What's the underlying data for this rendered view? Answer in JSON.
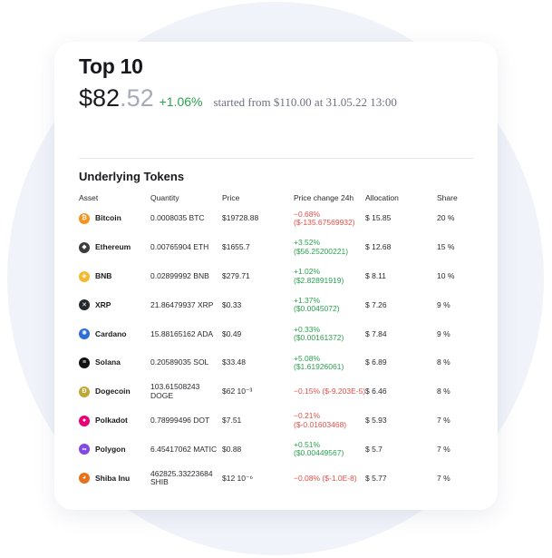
{
  "header": {
    "title": "Top 10",
    "price_int": "$82",
    "price_frac": ".52",
    "change": "+1.06%",
    "started": "started from $110.00 at 31.05.22 13:00"
  },
  "tokens": {
    "section_title": "Underlying Tokens",
    "columns": {
      "asset": "Asset",
      "quantity": "Quantity",
      "price": "Price",
      "change": "Price change 24h",
      "allocation": "Allocation",
      "share": "Share"
    },
    "rows": [
      {
        "name": "Bitcoin",
        "icon": "bitcoin-icon",
        "color": "#f7931a",
        "glyph": "₿",
        "quantity": "0.0008035 BTC",
        "price": "$19728.88",
        "change": "−0.68% ($-135.67569932)",
        "direction": "neg",
        "allocation": "$ 15.85",
        "share": "20 %"
      },
      {
        "name": "Ethereum",
        "icon": "ethereum-icon",
        "color": "#3c3c3d",
        "glyph": "◆",
        "quantity": "0.00765904 ETH",
        "price": "$1655.7",
        "change": "+3.52% ($56.25200221)",
        "direction": "pos",
        "allocation": "$ 12.68",
        "share": "15 %"
      },
      {
        "name": "BNB",
        "icon": "bnb-icon",
        "color": "#f3ba2f",
        "glyph": "◈",
        "quantity": "0.02899992 BNB",
        "price": "$279.71",
        "change": "+1.02% ($2.82891919)",
        "direction": "pos",
        "allocation": "$ 8.11",
        "share": "10 %"
      },
      {
        "name": "XRP",
        "icon": "xrp-icon",
        "color": "#23292f",
        "glyph": "✕",
        "quantity": "21.86479937 XRP",
        "price": "$0.33",
        "change": "+1.37% ($0.0045072)",
        "direction": "pos",
        "allocation": "$ 7.26",
        "share": "9 %"
      },
      {
        "name": "Cardano",
        "icon": "cardano-icon",
        "color": "#2b6cd6",
        "glyph": "✺",
        "quantity": "15.88165162 ADA",
        "price": "$0.49",
        "change": "+0.33% ($0.00161372)",
        "direction": "pos",
        "allocation": "$ 7.84",
        "share": "9 %"
      },
      {
        "name": "Solana",
        "icon": "solana-icon",
        "color": "#111111",
        "glyph": "≡",
        "quantity": "0.20589035 SOL",
        "price": "$33.48",
        "change": "+5.08% ($1.61926061)",
        "direction": "pos",
        "allocation": "$ 6.89",
        "share": "8 %"
      },
      {
        "name": "Dogecoin",
        "icon": "dogecoin-icon",
        "color": "#c2a633",
        "glyph": "Ð",
        "quantity": "103.61508243 DOGE",
        "price": "$62 10⁻³",
        "change": "−0.15% ($-9.203E-5)",
        "direction": "neg",
        "allocation": "$ 6.46",
        "share": "8 %"
      },
      {
        "name": "Polkadot",
        "icon": "polkadot-icon",
        "color": "#e6007a",
        "glyph": "●",
        "quantity": "0.78999496 DOT",
        "price": "$7.51",
        "change": "−0.21% ($-0.01603468)",
        "direction": "neg",
        "allocation": "$ 5.93",
        "share": "7 %"
      },
      {
        "name": "Polygon",
        "icon": "polygon-icon",
        "color": "#8247e5",
        "glyph": "∞",
        "quantity": "6.45417062 MATIC",
        "price": "$0.88",
        "change": "+0.51% ($0.00449567)",
        "direction": "pos",
        "allocation": "$ 5.7",
        "share": "7 %"
      },
      {
        "name": "Shiba Inu",
        "icon": "shiba-inu-icon",
        "color": "#e8711a",
        "glyph": "◕",
        "quantity": "462825.33223684 SHIB",
        "price": "$12 10⁻⁶",
        "change": "−0.08% ($-1.0E-8)",
        "direction": "neg",
        "allocation": "$ 5.77",
        "share": "7 %"
      }
    ]
  }
}
